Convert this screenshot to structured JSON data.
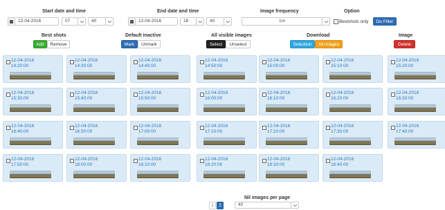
{
  "filters": {
    "start_label": "Start date and time",
    "start_date": "12-04-2016",
    "start_hour": "07",
    "start_minute": "40",
    "end_label": "End date and time",
    "end_date": "12-04-2016",
    "end_hour": "18",
    "end_minute": "40",
    "frequency_label": "Image frequency",
    "frequency_value": "1m",
    "option_label": "Option",
    "bestshots_label": "Bestshots only",
    "do_filter": "Do Filter"
  },
  "actions": {
    "bestshots_label": "Best shots",
    "add": "Add",
    "remove": "Remove",
    "default_inactive_label": "Default inactive",
    "mark": "Mark",
    "unmark": "Unmark",
    "all_visible_label": "All visible images",
    "select": "Select",
    "unselect": "Unselect",
    "download_label": "Download",
    "selection": "Selection",
    "all_images": "All images",
    "image_label": "Image",
    "delete": "Delete"
  },
  "images": [
    {
      "date": "12-04-2016",
      "time": "14:20:00"
    },
    {
      "date": "12-04-2016",
      "time": "14:30:00"
    },
    {
      "date": "12-04-2016",
      "time": "14:40:00"
    },
    {
      "date": "12-04-2016",
      "time": "14:50:00"
    },
    {
      "date": "12-04-2016",
      "time": "15:00:00"
    },
    {
      "date": "12-04-2016",
      "time": "15:10:00"
    },
    {
      "date": "12-04-2016",
      "time": "15:20:00"
    },
    {
      "date": "12-04-2016",
      "time": "15:30:00"
    },
    {
      "date": "12-04-2016",
      "time": "15:40:00"
    },
    {
      "date": "12-04-2016",
      "time": "15:50:00"
    },
    {
      "date": "12-04-2016",
      "time": "16:00:00"
    },
    {
      "date": "12-04-2016",
      "time": "16:10:00"
    },
    {
      "date": "12-04-2016",
      "time": "16:20:00"
    },
    {
      "date": "12-04-2016",
      "time": "16:30:00"
    },
    {
      "date": "12-04-2016",
      "time": "16:40:00"
    },
    {
      "date": "12-04-2016",
      "time": "16:50:00"
    },
    {
      "date": "12-04-2016",
      "time": "17:00:00"
    },
    {
      "date": "12-04-2016",
      "time": "17:10:00"
    },
    {
      "date": "12-04-2016",
      "time": "17:20:00"
    },
    {
      "date": "12-04-2016",
      "time": "17:30:00"
    },
    {
      "date": "12-04-2016",
      "time": "17:40:00"
    },
    {
      "date": "12-04-2016",
      "time": "17:50:00"
    },
    {
      "date": "12-04-2016",
      "time": "18:00:00"
    },
    {
      "date": "12-04-2016",
      "time": "18:10:00"
    },
    {
      "date": "12-04-2016",
      "time": "18:20:00"
    },
    {
      "date": "12-04-2016",
      "time": "18:30:00"
    },
    {
      "date": "12-04-2016",
      "time": "18:40:00"
    }
  ],
  "pagination": {
    "page1": "1",
    "page2": "2",
    "per_page_label": "Nil images per page",
    "per_page_value": "40"
  },
  "colors": {
    "card_bg": "#dbeaf7",
    "link": "#2a7ac0",
    "active_page": "#2e6db4"
  }
}
